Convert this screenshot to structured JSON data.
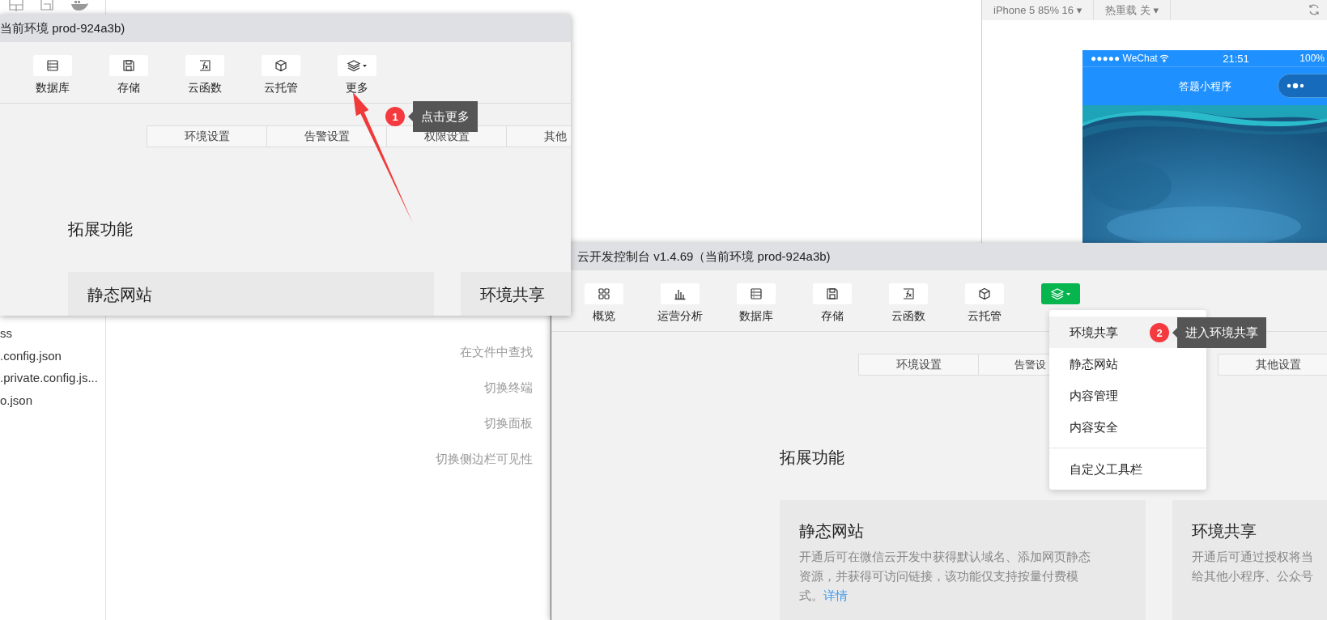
{
  "editor": {
    "files": [
      "ss",
      ".config.json",
      ".private.config.js...",
      "o.json"
    ],
    "shortcuts": [
      "在文件中查找",
      "切换终端",
      "切换面板",
      "切换侧边栏可见性"
    ]
  },
  "simulator": {
    "device": "iPhone 5 85% 16 ▾",
    "hot_reload": "热重载 关 ▾",
    "phone": {
      "carrier": "●●●●● WeChat",
      "time": "21:51",
      "battery": "100%",
      "title": "答题小程序"
    }
  },
  "windows": [
    {
      "title": "当前环境 prod-924a3b)",
      "toolbar": [
        {
          "label": "数据库",
          "kind": "list",
          "selected": false
        },
        {
          "label": "存储",
          "kind": "disk",
          "selected": false
        },
        {
          "label": "云函数",
          "kind": "function",
          "selected": false
        },
        {
          "label": "云托管",
          "kind": "cube",
          "selected": false
        },
        {
          "label": "更多",
          "kind": "layers",
          "selected": false
        }
      ],
      "tabs": [
        {
          "label": "环境设置"
        },
        {
          "label": "告警设置"
        },
        {
          "label": "权限设置"
        },
        {
          "label": "其他"
        }
      ],
      "section_title": "拓展功能",
      "cards": [
        {
          "title": "静态网站"
        },
        {
          "title": "环境共享"
        }
      ],
      "callout": {
        "number": "1",
        "text": "点击更多"
      }
    },
    {
      "title": "云开发控制台 v1.4.69（当前环境 prod-924a3b)",
      "toolbar": [
        {
          "label": "概览",
          "kind": "grid",
          "selected": false
        },
        {
          "label": "运营分析",
          "kind": "bars",
          "selected": false
        },
        {
          "label": "数据库",
          "kind": "list",
          "selected": false
        },
        {
          "label": "存储",
          "kind": "disk",
          "selected": false
        },
        {
          "label": "云函数",
          "kind": "function",
          "selected": false
        },
        {
          "label": "云托管",
          "kind": "cube",
          "selected": false
        },
        {
          "kind": "layers",
          "selected": true
        }
      ],
      "tabs": [
        {
          "label": "环境设置"
        },
        {
          "label": "告警设"
        },
        {
          "label": "其他设置"
        }
      ],
      "section_title": "拓展功能",
      "cards": [
        {
          "title": "静态网站",
          "description": "开通后可在微信云开发中获得默认域名、添加网页静态资源，并获得可访问链接，该功能仅支持按量付费模式。",
          "link": "详情"
        },
        {
          "title": "环境共享",
          "lines": [
            "开通后可通过授权将当",
            "给其他小程序、公众号"
          ]
        }
      ],
      "menu": {
        "items": [
          {
            "label": "环境共享",
            "selected": true
          },
          {
            "label": "静态网站",
            "selected": false
          },
          {
            "label": "内容管理",
            "selected": false
          },
          {
            "label": "内容安全",
            "selected": false
          }
        ],
        "footer_items": [
          {
            "label": "自定义工具栏",
            "selected": false
          }
        ]
      },
      "callout": {
        "number": "2",
        "text": "进入环境共享"
      }
    }
  ]
}
